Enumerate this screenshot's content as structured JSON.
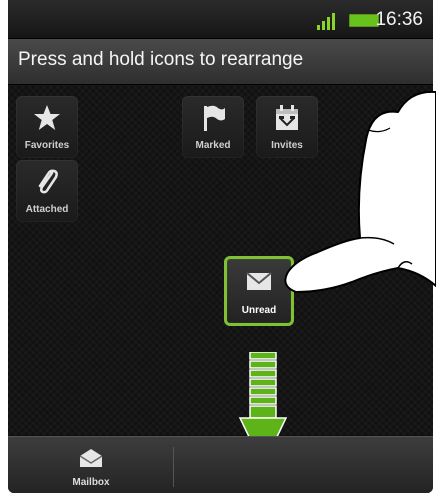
{
  "status_bar": {
    "time": "16:36"
  },
  "header": {
    "title": "Press and hold icons to rearrange"
  },
  "tiles": [
    {
      "label": "Favorites",
      "icon": "star-icon"
    },
    {
      "label": "Marked",
      "icon": "flag-icon"
    },
    {
      "label": "Invites",
      "icon": "calendar-icon"
    },
    {
      "label": "Attached",
      "icon": "paperclip-icon"
    },
    {
      "label": "Unread",
      "icon": "envelope-icon"
    }
  ],
  "bottom_bar": {
    "mailbox_label": "Mailbox",
    "icon": "mailbox-icon"
  },
  "colors": {
    "accent_green": "#7fc133",
    "arrow_green": "#5db318"
  }
}
